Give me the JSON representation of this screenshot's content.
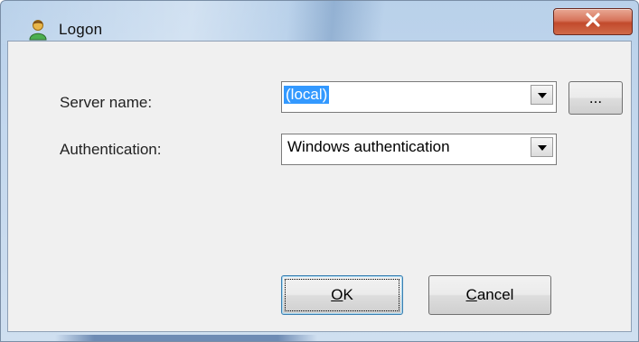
{
  "window": {
    "title": "Logon",
    "icon": "user-icon",
    "close_icon": "close-icon"
  },
  "form": {
    "server_label": "Server name:",
    "server_value": "(local)",
    "browse_label": "...",
    "auth_label": "Authentication:",
    "auth_value": "Windows authentication"
  },
  "buttons": {
    "ok_accel": "O",
    "ok_rest": "K",
    "cancel_accel": "C",
    "cancel_rest": "ancel"
  },
  "colors": {
    "selection": "#3399ff",
    "close_button": "#c24a2c",
    "title_bar": "#b9d1ea"
  }
}
